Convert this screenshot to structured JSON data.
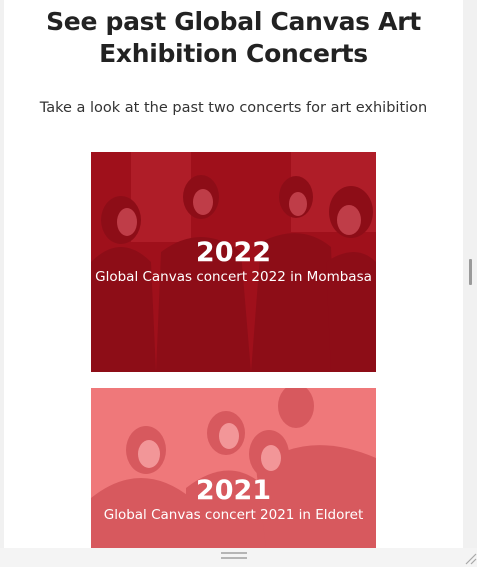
{
  "heading": "See past Global Canvas Art Exhibition Concerts",
  "intro": "Take a look at the past two concerts for art exhibition",
  "concerts": [
    {
      "year": "2022",
      "caption": "Global Canvas concert 2022 in Mombasa",
      "tint": "#b3121e"
    },
    {
      "year": "2021",
      "caption": "Global Canvas concert 2021 in Eldoret",
      "tint": "#f07678"
    }
  ],
  "icons": {
    "scrollbar": "scrollbar-thumb",
    "grip": "resize-grip-icon",
    "corner": "resize-corner-icon"
  }
}
